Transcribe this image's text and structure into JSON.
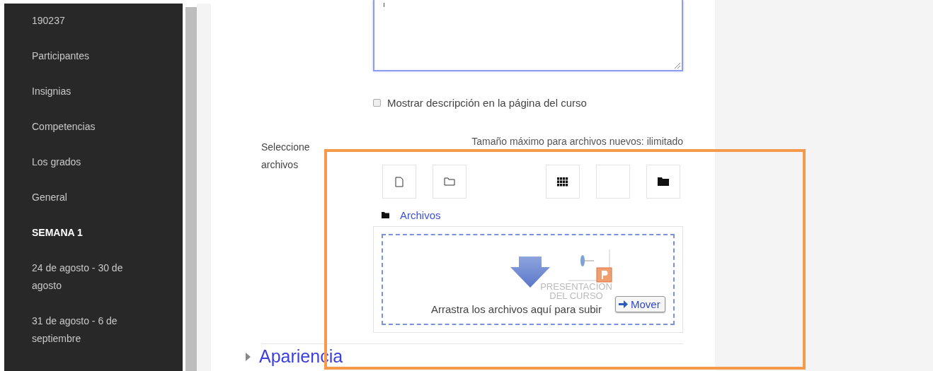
{
  "sidebar": {
    "items": [
      {
        "label": "190237",
        "kind": "link"
      },
      {
        "label": "Participantes",
        "kind": "link"
      },
      {
        "label": "Insignias",
        "kind": "link"
      },
      {
        "label": "Competencias",
        "kind": "link"
      },
      {
        "label": "Los grados",
        "kind": "link"
      },
      {
        "label": "General",
        "kind": "link"
      },
      {
        "label": "SEMANA 1",
        "kind": "heading"
      },
      {
        "label": "24 de agosto - 30 de agosto",
        "kind": "link"
      },
      {
        "label": "31 de agosto - 6 de septiembre",
        "kind": "link"
      }
    ]
  },
  "description_checkbox": {
    "label": "Mostrar descripción en la página del curso",
    "checked": false
  },
  "file_picker": {
    "label": "Seleccione archivos",
    "max_size": "Tamaño máximo para archivos nuevos: ilimitado",
    "toolbar": [
      {
        "kind": "file"
      },
      {
        "kind": "folder"
      },
      {
        "kind": "spacer"
      },
      {
        "kind": "grid"
      },
      {
        "kind": "blank"
      },
      {
        "kind": "folder-solid"
      }
    ],
    "path": "Archivos",
    "dropzone_text": "Arrastra los archivos aquí para subir",
    "drag": {
      "file_label": "PRESENTACION DEL CURSO",
      "action": "Mover"
    }
  },
  "section": {
    "title": "Apariencia",
    "expanded": false
  }
}
